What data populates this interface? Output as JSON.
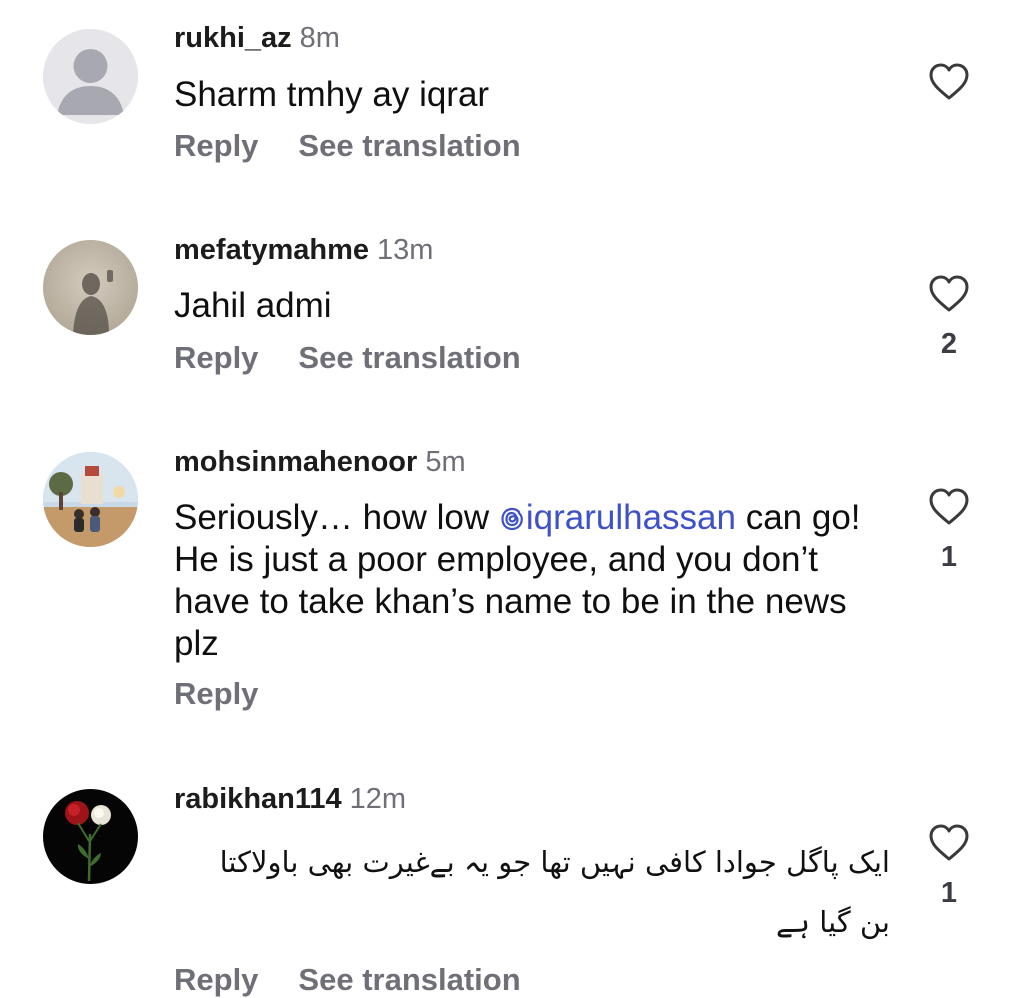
{
  "colors": {
    "link": "#3f51c9",
    "muted": "#6f6f78"
  },
  "comments": [
    {
      "username": "rukhi_az",
      "time": "8m",
      "text": "Sharm tmhy ay iqrar",
      "reply": "Reply",
      "translate": "See translation",
      "likes": ""
    },
    {
      "username": "mefatymahme",
      "time": "13m",
      "text": "Jahil admi",
      "reply": "Reply",
      "translate": "See translation",
      "likes": "2"
    },
    {
      "username": "mohsinmahenoor",
      "time": "5m",
      "text_before": "Seriously… how low ",
      "mention": "iqrarulhassan",
      "text_after": " can go! He is just a poor employee, and you don’t have to take khan’s name to be in the news plz",
      "reply": "Reply",
      "likes": "1"
    },
    {
      "username": "rabikhan114",
      "time": "12m",
      "text": "ایک پاگل جوادا کافی نہیں تھا جو یہ  بےغیرت بھی باولاکتا بن گیا ہے",
      "reply": "Reply",
      "translate": "See translation",
      "likes": "1"
    }
  ]
}
